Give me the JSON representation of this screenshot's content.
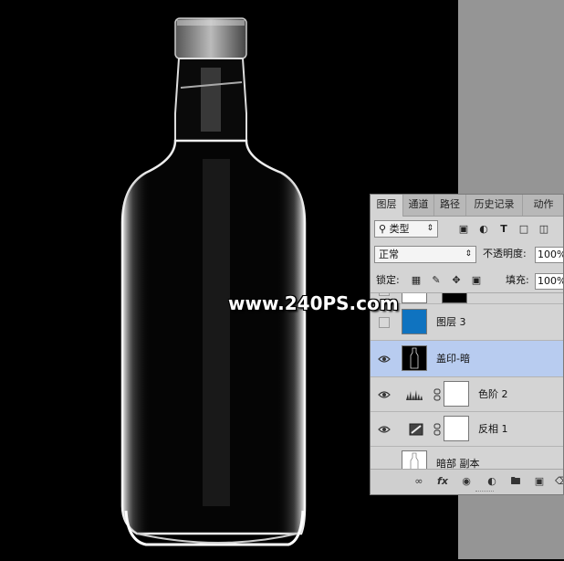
{
  "watermark": "www.240PS.com",
  "panel": {
    "tabs": [
      {
        "label": "图层",
        "active": true
      },
      {
        "label": "通道",
        "active": false
      },
      {
        "label": "路径",
        "active": false
      },
      {
        "label": "历史记录",
        "active": false
      },
      {
        "label": "动作",
        "active": false
      }
    ],
    "filter": {
      "icon": "search-icon",
      "label": "类型"
    },
    "blend_mode": "正常",
    "opacity_label": "不透明度:",
    "opacity_value": "100%",
    "lock_label": "锁定:",
    "fill_label": "填充:",
    "fill_value": "100%",
    "layers": [
      {
        "name": "",
        "visible": false,
        "thumb": "white-black"
      },
      {
        "name": "图层 3",
        "visible": false,
        "thumb": "blue"
      },
      {
        "name": "盖印-暗",
        "visible": true,
        "selected": true,
        "thumb": "bottle-dark"
      },
      {
        "name": "色阶 2",
        "visible": true,
        "adjustment": "levels-icon"
      },
      {
        "name": "反相 1",
        "visible": true,
        "adjustment": "invert-icon"
      },
      {
        "name": "暗部 副本",
        "visible": false,
        "thumb": "bottle-light"
      }
    ],
    "bottom_icons": [
      "link-icon",
      "fx-icon",
      "mask-icon",
      "adjustment-icon",
      "folder-icon",
      "new-layer-icon",
      "trash-icon"
    ],
    "fx_label": "fx"
  },
  "colors": {
    "selected_row": "#b8ccf0",
    "blue_thumb": "#0f73c0",
    "panel_bg": "#d4d4d4"
  }
}
